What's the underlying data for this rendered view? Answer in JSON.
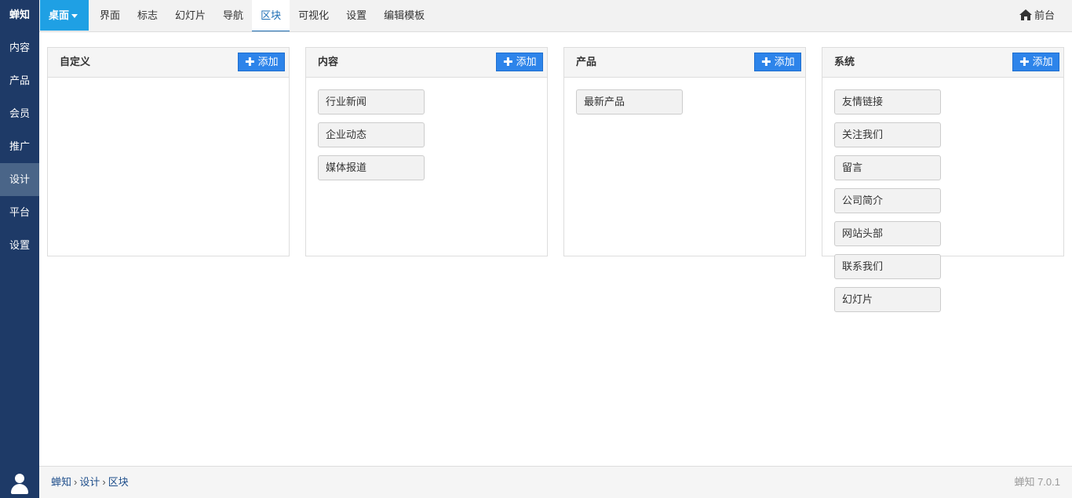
{
  "app": {
    "brand": "蝉知"
  },
  "sidebar": {
    "items": [
      {
        "label": "内容"
      },
      {
        "label": "产品"
      },
      {
        "label": "会员"
      },
      {
        "label": "推广"
      },
      {
        "label": "设计",
        "active": true
      },
      {
        "label": "平台"
      },
      {
        "label": "设置"
      }
    ],
    "user_icon": "user-icon"
  },
  "topbar": {
    "desk_label": "桌面",
    "nav": [
      {
        "label": "界面"
      },
      {
        "label": "标志"
      },
      {
        "label": "幻灯片"
      },
      {
        "label": "导航"
      },
      {
        "label": "区块",
        "active": true
      },
      {
        "label": "可视化"
      },
      {
        "label": "设置"
      },
      {
        "label": "编辑模板"
      }
    ],
    "front_label": "前台",
    "front_icon": "home-icon"
  },
  "panels": [
    {
      "title": "自定义",
      "add_label": "添加",
      "blocks": []
    },
    {
      "title": "内容",
      "add_label": "添加",
      "blocks": [
        "行业新闻",
        "企业动态",
        "媒体报道"
      ]
    },
    {
      "title": "产品",
      "add_label": "添加",
      "blocks": [
        "最新产品"
      ]
    },
    {
      "title": "系统",
      "add_label": "添加",
      "blocks": [
        "友情链接",
        "关注我们",
        "留言",
        "公司简介",
        "网站头部",
        "联系我们",
        "幻灯片"
      ]
    }
  ],
  "footer": {
    "breadcrumb": [
      "蝉知",
      "设计",
      "区块"
    ],
    "version": "蝉知 7.0.1"
  },
  "colors": {
    "sidebar_bg": "#1e3a67",
    "sidebar_active": "#4a6588",
    "accent": "#1fa0e4",
    "button": "#2d84ea",
    "active_nav_text": "#1f6fb5"
  }
}
